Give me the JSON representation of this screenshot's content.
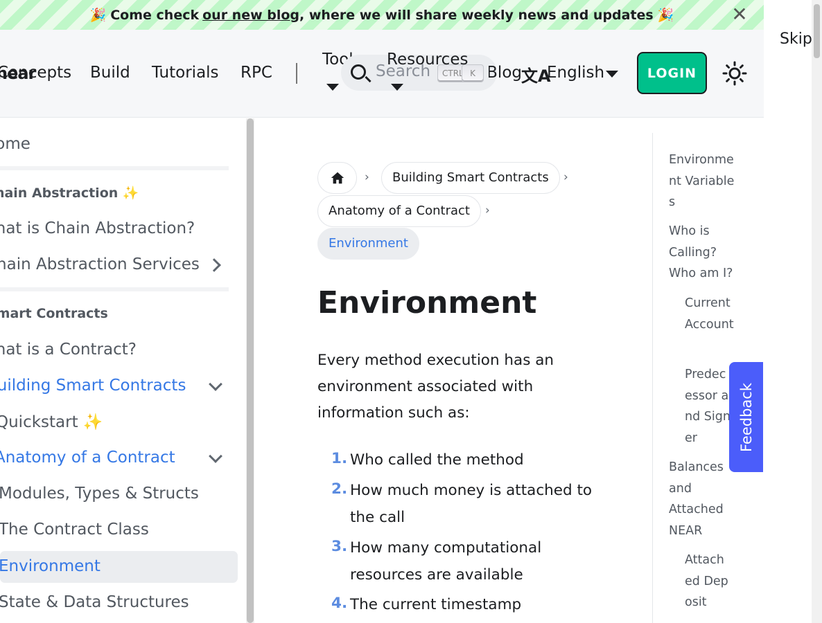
{
  "announcement": {
    "emoji_left": "🎉",
    "prefix": "Come check",
    "link": "our new blog",
    "suffix": ", where we will share weekly news and updates",
    "emoji_right": "🎉",
    "close_icon": "close-icon"
  },
  "navbar": {
    "logo": "near",
    "items": [
      "Concepts",
      "Build",
      "Tutorials",
      "RPC"
    ],
    "tools": "Tools",
    "resources": "Resources",
    "search_placeholder": "Search",
    "kbd_ctrl": "CTRL",
    "kbd_k": "K",
    "blog": "Blog",
    "lang_icon": "文A",
    "language": "English",
    "login": "LOGIN",
    "theme_icon": "sun-icon"
  },
  "skip": "Skip to main content",
  "sidebar": {
    "home": "Home",
    "cat_chain": "Chain Abstraction ✨",
    "what_chain": "What is Chain Abstraction?",
    "chain_services": "Chain Abstraction Services",
    "cat_smart": "Smart Contracts",
    "what_contract": "What is a Contract?",
    "building": "Building Smart Contracts",
    "quickstart": "Quickstart ✨",
    "anatomy": "Anatomy of a Contract",
    "modules": "Modules, Types & Structs",
    "contract_class": "The Contract Class",
    "environment": "Environment",
    "state": "State & Data Structures"
  },
  "breadcrumbs": {
    "home_icon": "home-icon",
    "b1": "Building Smart Contracts",
    "b2": "Anatomy of a Contract",
    "b3": "Environment",
    "sep": "›"
  },
  "content": {
    "title": "Environment",
    "intro": "Every method execution has an environment associated with information such as:",
    "list": [
      {
        "num": "1.",
        "text": "Who called the method"
      },
      {
        "num": "2.",
        "text": "How much money is attached to the call"
      },
      {
        "num": "3.",
        "text": "How many computational resources are available"
      },
      {
        "num": "4.",
        "text": "The current timestamp"
      }
    ]
  },
  "toc": {
    "t1": "Environment Variables",
    "t2": "Who is Calling? Who am I?",
    "t3": "Current Account",
    "t4": "Predecessor and Signer",
    "t5": "Balances and Attached NEAR",
    "t6": "Attached Deposit"
  },
  "feedback": "Feedback",
  "colors": {
    "accent": "#3578e5",
    "login_bg": "#00c08b",
    "feedback_bg": "#4b5dfa"
  }
}
